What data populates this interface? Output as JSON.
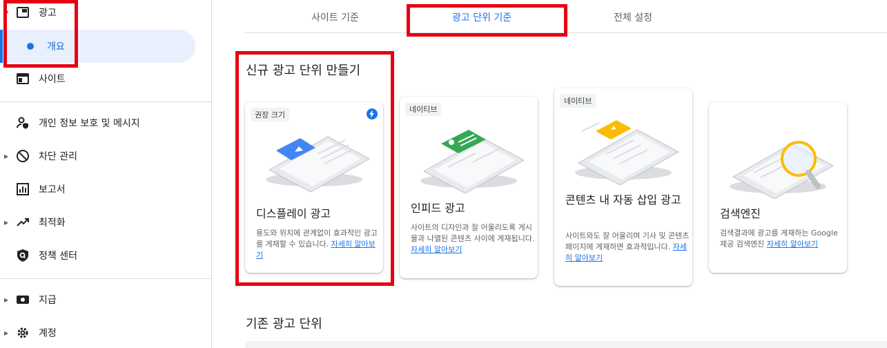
{
  "sidebar": {
    "items": [
      {
        "label": "광고",
        "icon": "ads-icon"
      },
      {
        "label": "개요",
        "icon": "dot-icon"
      },
      {
        "label": "사이트",
        "icon": "site-icon"
      },
      {
        "label": "개인 정보 보호 및 메시지",
        "icon": "privacy-icon"
      },
      {
        "label": "차단 관리",
        "icon": "block-icon"
      },
      {
        "label": "보고서",
        "icon": "report-icon"
      },
      {
        "label": "최적화",
        "icon": "trending-icon"
      },
      {
        "label": "정책 센터",
        "icon": "shield-icon"
      },
      {
        "label": "지급",
        "icon": "payment-icon"
      },
      {
        "label": "계정",
        "icon": "gear-icon"
      }
    ]
  },
  "tabs": [
    {
      "label": "사이트 기준"
    },
    {
      "label": "광고 단위 기준"
    },
    {
      "label": "전체 설정"
    }
  ],
  "new_section_title": "신규 광고 단위 만들기",
  "cards": [
    {
      "chip": "권장 크기",
      "title": "디스플레이 광고",
      "desc": "용도와 위치에 관계없이 효과적인 광고를 게재할 수 있습니다.",
      "link": "자세히 알아보기",
      "accent": "#4285f4"
    },
    {
      "chip": "네이티브",
      "title": "인피드 광고",
      "desc": "사이트의 디자인과 잘 어울리도록 게시물과 나열된 콘텐츠 사이에 게재됩니다.",
      "link": "자세히 알아보기",
      "accent": "#34a853"
    },
    {
      "chip": "네이티브",
      "title": "콘텐츠 내 자동 삽입 광고",
      "desc": "사이트와도 잘 어울리며 기사 및 콘텐츠 페이지에 게재하면 효과적입니다.",
      "link": "자세히 알아보기",
      "accent": "#fbbc04"
    },
    {
      "chip": "",
      "title": "검색엔진",
      "desc": "검색결과에 광고를 게재하는 Google 제공 검색엔진",
      "link": "자세히 알아보기",
      "accent": "#fbbc04"
    }
  ],
  "existing_section_title": "기존 광고 단위",
  "colors": {
    "accent": "#1a73e8",
    "highlight": "#e60012"
  }
}
